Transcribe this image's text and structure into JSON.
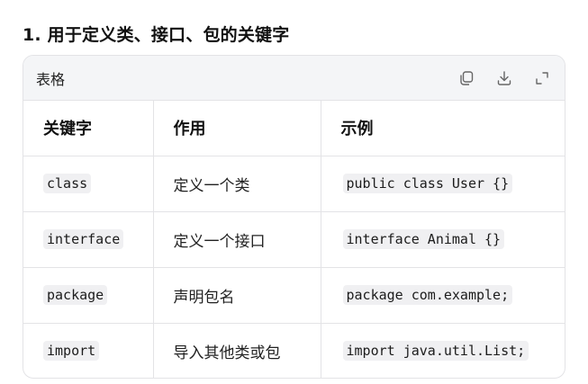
{
  "heading": "1. 用于定义类、接口、包的关键字",
  "card": {
    "title": "表格",
    "actions": [
      {
        "icon": "copy-icon"
      },
      {
        "icon": "download-icon"
      },
      {
        "icon": "expand-icon"
      }
    ]
  },
  "table": {
    "headers": [
      "关键字",
      "作用",
      "示例"
    ],
    "rows": [
      {
        "keyword": "class",
        "purpose": "定义一个类",
        "example": "public class User {}"
      },
      {
        "keyword": "interface",
        "purpose": "定义一个接口",
        "example": "interface Animal {}"
      },
      {
        "keyword": "package",
        "purpose": "声明包名",
        "example": "package com.example;"
      },
      {
        "keyword": "import",
        "purpose": "导入其他类或包",
        "example": "import java.util.List;"
      }
    ]
  }
}
